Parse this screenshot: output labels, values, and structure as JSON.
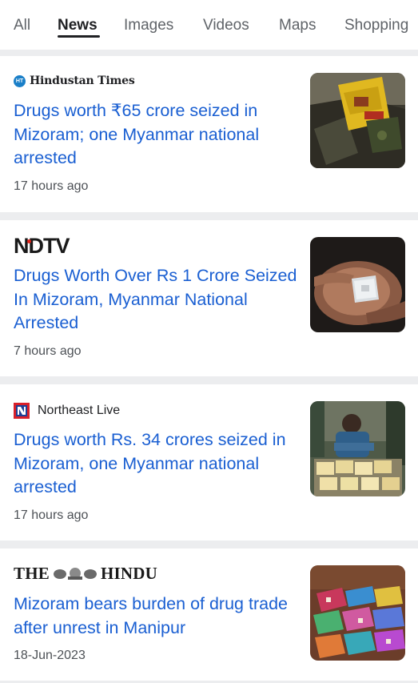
{
  "tabs": [
    {
      "label": "All",
      "active": false
    },
    {
      "label": "News",
      "active": true
    },
    {
      "label": "Images",
      "active": false
    },
    {
      "label": "Videos",
      "active": false
    },
    {
      "label": "Maps",
      "active": false
    },
    {
      "label": "Shopping",
      "active": false
    }
  ],
  "articles": [
    {
      "source": "Hindustan Times",
      "source_badge": "HT",
      "title": "Drugs worth ₹65 crore seized in Mizoram; one Myanmar national arrested",
      "time": "17 hours ago",
      "thumbnail_icon": "drug-packets-image"
    },
    {
      "source": "NDTV",
      "title": "Drugs Worth Over Rs 1 Crore Seized In Mizoram, Myanmar National Arrested",
      "time": "7 hours ago",
      "thumbnail_icon": "hand-holding-packet-image"
    },
    {
      "source": "Northeast Live",
      "title": "Drugs worth Rs. 34 crores seized in Mizoram, one Myanmar national arrested",
      "time": "17 hours ago",
      "thumbnail_icon": "arrested-man-with-packets-image"
    },
    {
      "source_left": "THE",
      "source_right": "HINDU",
      "title": "Mizoram bears burden of drug trade after unrest in Manipur",
      "time": "18-Jun-2023",
      "thumbnail_icon": "seized-drugs-spread-image"
    }
  ],
  "colors": {
    "headline": "#1a5fd2",
    "divider": "#ecedef",
    "ht_badge": "#1a7fc8",
    "ndtv_accent": "#e2231a"
  }
}
